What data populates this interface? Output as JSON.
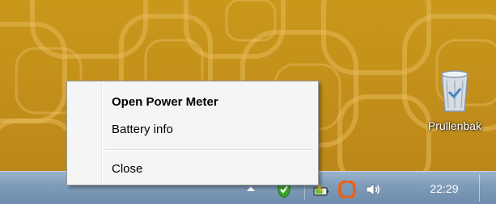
{
  "desktop": {
    "recycle_bin_label": "Prullenbak",
    "wallpaper_color": "#c9981b",
    "wallpaper_icon": "rounded-square-pattern"
  },
  "context_menu": {
    "items": [
      {
        "label": "Open Power Meter",
        "default": true
      },
      {
        "label": "Battery info",
        "default": false
      },
      {
        "label": "Close",
        "default": false
      }
    ]
  },
  "taskbar": {
    "color": "#7f9cb9",
    "tray_icons": [
      "show-hidden-icons-arrow",
      "shield-check-icon",
      "power-meter-icon",
      "orange-app-icon",
      "volume-icon"
    ],
    "clock": "22:29"
  },
  "colors": {
    "menu_background": "#f5f5f5",
    "menu_border": "#979797",
    "shield_green": "#3aa52a",
    "app_orange": "#e2641c"
  }
}
